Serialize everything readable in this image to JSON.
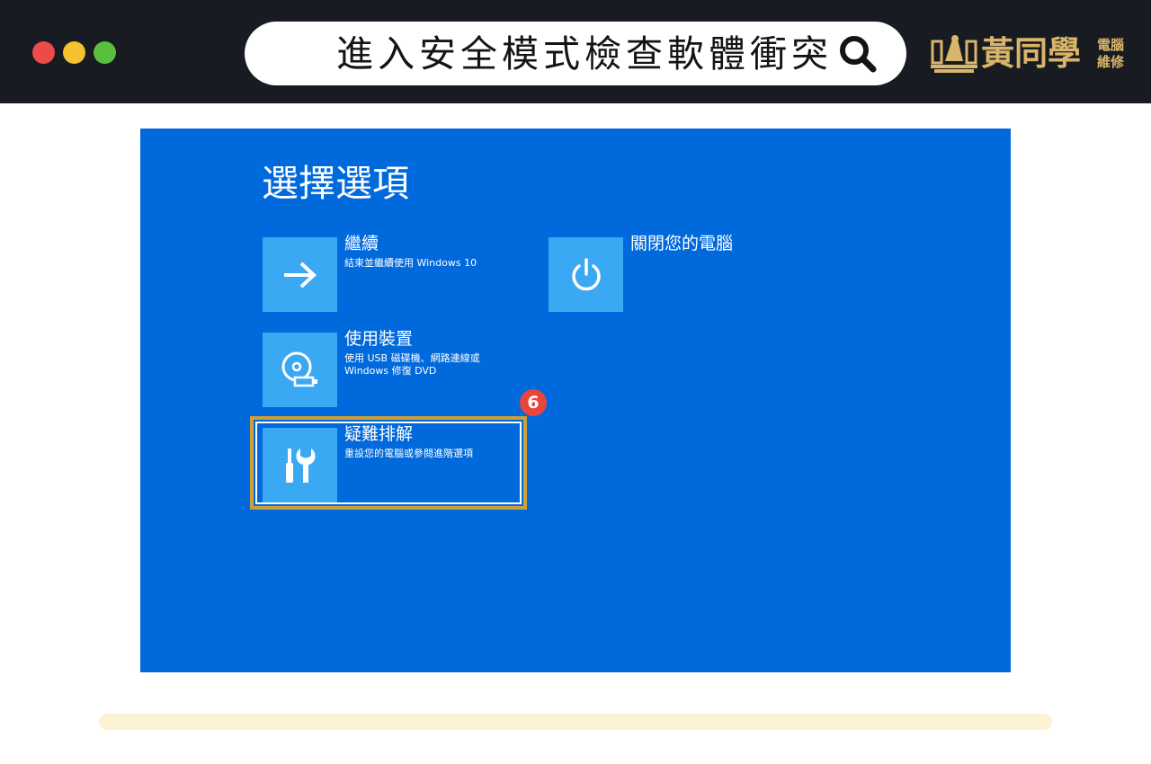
{
  "window": {
    "controls": [
      "close",
      "minimize",
      "maximize"
    ],
    "colors": {
      "close": "#ee4a4a",
      "minimize": "#f5c12e",
      "maximize": "#58c03e"
    }
  },
  "search": {
    "query": "進入安全模式檢查軟體衝突",
    "icon": "search-icon"
  },
  "brand": {
    "name": "黃同學",
    "tagline_line1": "電腦",
    "tagline_line2": "維修",
    "color": "#d9b56b"
  },
  "screen": {
    "title": "選擇選項",
    "background": "#0069dc",
    "tile_color": "#3aa8f3",
    "options": [
      {
        "id": "continue",
        "label": "繼續",
        "description": "結束並繼續使用 Windows 10",
        "icon": "arrow-right-icon"
      },
      {
        "id": "use-device",
        "label": "使用裝置",
        "description": "使用 USB 磁碟機、網路連線或 Windows 修復 DVD",
        "icon": "disc-usb-icon"
      },
      {
        "id": "troubleshoot",
        "label": "疑難排解",
        "description": "重設您的電腦或參閱進階選項",
        "icon": "tools-icon"
      },
      {
        "id": "power-off",
        "label": "關閉您的電腦",
        "description": "",
        "icon": "power-icon"
      }
    ]
  },
  "annotation": {
    "step_number": "6",
    "highlight_target": "troubleshoot",
    "frame_color": "#cba03a",
    "badge_color": "#e8453c"
  }
}
